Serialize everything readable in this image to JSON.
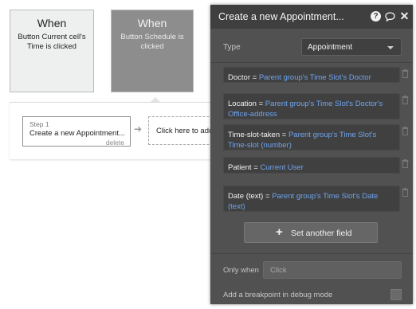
{
  "triggers": [
    {
      "title": "When",
      "description": "Button Current cell's Time is clicked"
    },
    {
      "title": "When",
      "description": "Button Schedule is clicked"
    }
  ],
  "actions": {
    "step_number": "Step 1",
    "step_name": "Create a new Appointment...",
    "delete_label": "delete",
    "add_action_label": "Click here to add"
  },
  "panel": {
    "title": "Create a new Appointment...",
    "icons": [
      "help-icon",
      "comment-icon",
      "close-icon"
    ],
    "type_label": "Type",
    "type_value": "Appointment",
    "fields": [
      {
        "key": "Doctor",
        "eq": "=",
        "value": "Parent group's Time Slot's Doctor"
      },
      {
        "key": "Location",
        "eq": "=",
        "value": "Parent group's Time Slot's Doctor's Office-address"
      },
      {
        "key": "Time-slot-taken",
        "eq": "=",
        "value": "Parent group's Time Slot's Time-slot (number)"
      },
      {
        "key": "Patient",
        "eq": "=",
        "value": "Current User"
      },
      {
        "key": "Date (text)",
        "eq": "=",
        "value": "Parent group's Time Slot's Date (text)"
      }
    ],
    "set_field_label": "Set another field",
    "only_when_label": "Only when",
    "only_when_placeholder": "Click",
    "breakpoint_label": "Add a breakpoint in debug mode"
  },
  "colors": {
    "panel_bg": "#515151",
    "header_bg": "#3f3f3f",
    "expression_blue": "#6fa4ee",
    "selected_trigger": "#8d8d8d"
  }
}
